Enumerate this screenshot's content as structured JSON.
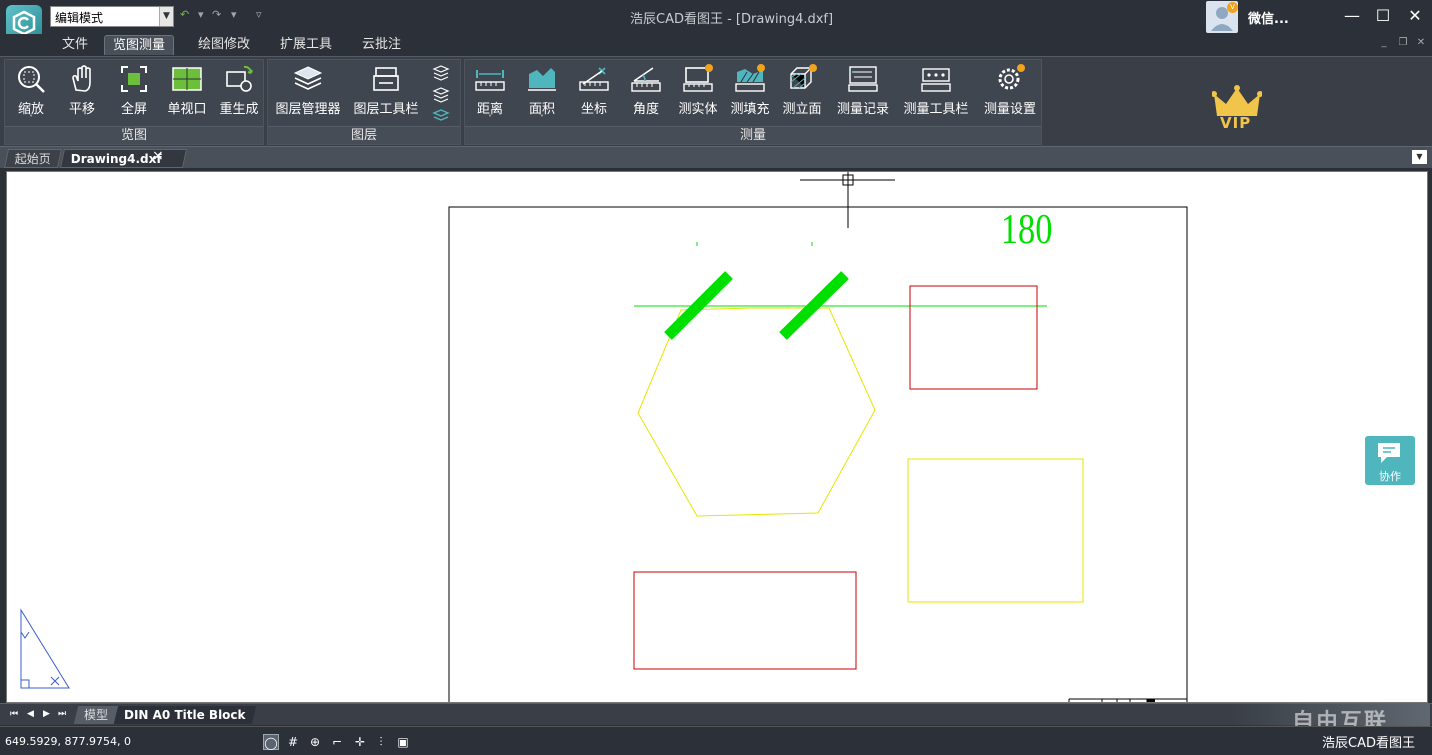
{
  "titlebar": {
    "mode_select": "编辑模式",
    "window_title": "浩辰CAD看图王 - [Drawing4.dxf]",
    "user_name": "微信...",
    "user_badge": "V"
  },
  "menu": {
    "items": [
      "文件",
      "览图测量",
      "绘图修改",
      "扩展工具",
      "云批注"
    ],
    "active": "览图测量"
  },
  "ribbon": {
    "panels": [
      {
        "title": "览图",
        "tools": [
          "缩放",
          "平移",
          "全屏",
          "单视口",
          "重生成"
        ]
      },
      {
        "title": "图层",
        "tools": [
          "图层管理器",
          "图层工具栏"
        ]
      },
      {
        "title": "测量",
        "tools": [
          "距离",
          "面积",
          "坐标",
          "角度",
          "测实体",
          "测填充",
          "测立面",
          "测量记录",
          "测量工具栏",
          "测量设置"
        ]
      }
    ],
    "vip_label": "VIP"
  },
  "tabs": {
    "items": [
      "起始页",
      "Drawing4.dxf"
    ],
    "active": "Drawing4.dxf",
    "close_glyph": "×"
  },
  "drawing": {
    "dimension_text": "180",
    "colors": {
      "green": "#00e000",
      "yellow": "#e6e600",
      "red": "#cc0000",
      "border": "#000000"
    }
  },
  "collab_label": "协作",
  "layout_tabs": {
    "items": [
      "模型",
      "DIN A0 Title Block"
    ],
    "active": "DIN A0 Title Block"
  },
  "watermark": "自由互联",
  "status": {
    "coordinates": "649.5929, 877.9754, 0",
    "brand": "浩辰CAD看图王"
  }
}
